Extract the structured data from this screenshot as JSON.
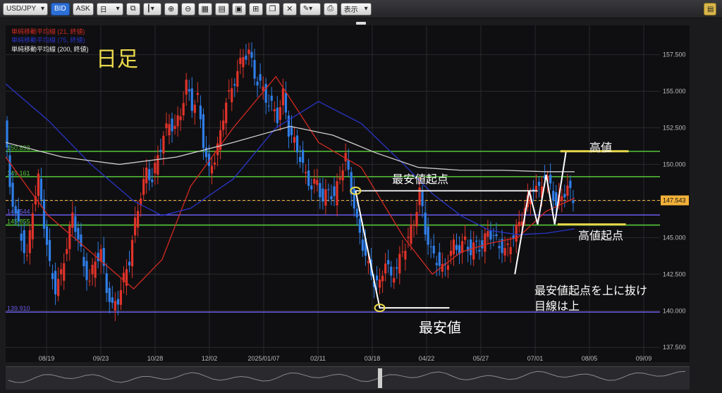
{
  "toolbar": {
    "symbol": "USD/JPY",
    "bid": "BID",
    "ask": "ASK",
    "period": "日",
    "display": "表示"
  },
  "legend": {
    "sma21": "単純移動平均線 (21, 終値)",
    "sma75": "単純移動平均線 (75, 終値)",
    "sma200": "単純移動平均線 (200, 終値)"
  },
  "annotations": {
    "timeframe": "日足",
    "high": "高値",
    "lowest_start": "最安値起点",
    "high_start": "高値起点",
    "lowest": "最安値",
    "note1": "最安値起点を上に抜け",
    "note2": "目線は上"
  },
  "colors": {
    "up": "#e0332a",
    "down": "#2f7ee8",
    "sma21": "#d22a22",
    "sma75": "#2a35c8",
    "sma200": "#cfcfcf",
    "green_line": "#58c83a",
    "purple_line": "#6a5ce8",
    "current": "#f2b13a",
    "annotation": "#e8d84a",
    "drawing": "#ffffff"
  },
  "chart_data": {
    "type": "candlestick",
    "pair": "USD/JPY",
    "timeframe": "daily",
    "ylim": [
      136.5,
      159.5
    ],
    "y_ticks": [
      "137.500",
      "140.000",
      "142.500",
      "145.000",
      "147.500",
      "150.000",
      "152.500",
      "155.000",
      "157.500"
    ],
    "x_ticks": [
      "08/19",
      "09/23",
      "10/28",
      "12/02",
      "2025/01/07",
      "02/11",
      "03/18",
      "04/22",
      "05/27",
      "07/01",
      "08/05",
      "09/09"
    ],
    "current_price": "147.543",
    "levels": [
      {
        "value": 150.893,
        "label": "150.893",
        "color": "green"
      },
      {
        "value": 149.161,
        "label": "149.161",
        "color": "green"
      },
      {
        "value": 146.544,
        "label": "146.544",
        "color": "purple"
      },
      {
        "value": 145.855,
        "label": "145.855",
        "color": "green"
      },
      {
        "value": 139.91,
        "label": "139.910",
        "color": "purple"
      }
    ],
    "price_path": [
      [
        0,
        153.0
      ],
      [
        4,
        148.5
      ],
      [
        8,
        146.5
      ],
      [
        12,
        145.0
      ],
      [
        16,
        143.5
      ],
      [
        20,
        147.0
      ],
      [
        24,
        149.0
      ],
      [
        28,
        146.0
      ],
      [
        32,
        143.0
      ],
      [
        36,
        141.5
      ],
      [
        40,
        142.5
      ],
      [
        44,
        144.5
      ],
      [
        48,
        146.5
      ],
      [
        52,
        145.0
      ],
      [
        56,
        143.0
      ],
      [
        60,
        142.0
      ],
      [
        64,
        143.5
      ],
      [
        68,
        144.0
      ],
      [
        72,
        141.5
      ],
      [
        76,
        140.2
      ],
      [
        80,
        140.8
      ],
      [
        84,
        142.2
      ],
      [
        88,
        143.5
      ],
      [
        92,
        146.0
      ],
      [
        96,
        148.0
      ],
      [
        100,
        149.5
      ],
      [
        104,
        149.0
      ],
      [
        108,
        150.5
      ],
      [
        112,
        152.0
      ],
      [
        116,
        152.8
      ],
      [
        120,
        152.5
      ],
      [
        124,
        153.5
      ],
      [
        128,
        155.5
      ],
      [
        132,
        154.0
      ],
      [
        136,
        154.5
      ],
      [
        140,
        151.5
      ],
      [
        144,
        149.5
      ],
      [
        148,
        150.5
      ],
      [
        152,
        152.0
      ],
      [
        156,
        154.5
      ],
      [
        160,
        155.0
      ],
      [
        164,
        156.5
      ],
      [
        168,
        157.3
      ],
      [
        172,
        157.8
      ],
      [
        176,
        156.0
      ],
      [
        180,
        155.5
      ],
      [
        184,
        154.5
      ],
      [
        188,
        154.0
      ],
      [
        192,
        153.2
      ],
      [
        196,
        154.8
      ],
      [
        200,
        152.3
      ],
      [
        204,
        151.5
      ],
      [
        208,
        150.5
      ],
      [
        212,
        149.2
      ],
      [
        216,
        148.5
      ],
      [
        220,
        148.8
      ],
      [
        224,
        147.5
      ],
      [
        228,
        148.3
      ],
      [
        232,
        147.7
      ],
      [
        236,
        149.3
      ],
      [
        240,
        150.5
      ],
      [
        244,
        148.3
      ],
      [
        248,
        146.0
      ],
      [
        252,
        144.5
      ],
      [
        256,
        143.0
      ],
      [
        260,
        142.0
      ],
      [
        264,
        141.8
      ],
      [
        268,
        143.5
      ],
      [
        272,
        142.2
      ],
      [
        276,
        143.0
      ],
      [
        280,
        144.0
      ],
      [
        284,
        145.0
      ],
      [
        288,
        146.0
      ],
      [
        292,
        148.2
      ],
      [
        296,
        145.5
      ],
      [
        300,
        144.0
      ],
      [
        304,
        143.5
      ],
      [
        308,
        142.8
      ],
      [
        312,
        143.5
      ],
      [
        316,
        144.5
      ],
      [
        320,
        144.2
      ],
      [
        324,
        144.8
      ],
      [
        328,
        144.0
      ],
      [
        332,
        144.6
      ],
      [
        336,
        144.3
      ],
      [
        340,
        145.5
      ],
      [
        344,
        145.0
      ],
      [
        348,
        144.5
      ],
      [
        352,
        144.0
      ],
      [
        356,
        144.7
      ],
      [
        360,
        145.5
      ],
      [
        364,
        146.5
      ],
      [
        368,
        147.5
      ],
      [
        372,
        148.5
      ],
      [
        376,
        148.2
      ],
      [
        380,
        149.3
      ],
      [
        384,
        148.5
      ],
      [
        388,
        147.3
      ],
      [
        392,
        147.8
      ],
      [
        396,
        148.5
      ],
      [
        400,
        147.5
      ]
    ],
    "sma21": [
      [
        0,
        150.5
      ],
      [
        30,
        146.5
      ],
      [
        60,
        144.0
      ],
      [
        90,
        141.5
      ],
      [
        110,
        143.5
      ],
      [
        130,
        148.5
      ],
      [
        160,
        152.5
      ],
      [
        190,
        156.0
      ],
      [
        220,
        151.5
      ],
      [
        250,
        149.8
      ],
      [
        280,
        145.0
      ],
      [
        300,
        142.5
      ],
      [
        320,
        144.0
      ],
      [
        340,
        144.6
      ],
      [
        360,
        145.0
      ],
      [
        380,
        146.8
      ],
      [
        400,
        147.7
      ]
    ],
    "sma75": [
      [
        0,
        155.5
      ],
      [
        30,
        153.0
      ],
      [
        60,
        150.0
      ],
      [
        90,
        147.5
      ],
      [
        110,
        146.5
      ],
      [
        130,
        147.0
      ],
      [
        160,
        149.0
      ],
      [
        190,
        152.5
      ],
      [
        220,
        154.3
      ],
      [
        250,
        152.8
      ],
      [
        280,
        150.0
      ],
      [
        300,
        148.0
      ],
      [
        320,
        146.5
      ],
      [
        340,
        145.5
      ],
      [
        360,
        145.2
      ],
      [
        380,
        145.3
      ],
      [
        400,
        145.6
      ]
    ],
    "sma200": [
      [
        0,
        151.5
      ],
      [
        40,
        150.5
      ],
      [
        80,
        150.0
      ],
      [
        120,
        150.5
      ],
      [
        160,
        151.5
      ],
      [
        200,
        152.6
      ],
      [
        230,
        152.0
      ],
      [
        260,
        150.8
      ],
      [
        290,
        149.8
      ],
      [
        320,
        149.6
      ],
      [
        350,
        149.6
      ],
      [
        380,
        149.5
      ],
      [
        400,
        149.5
      ]
    ]
  }
}
